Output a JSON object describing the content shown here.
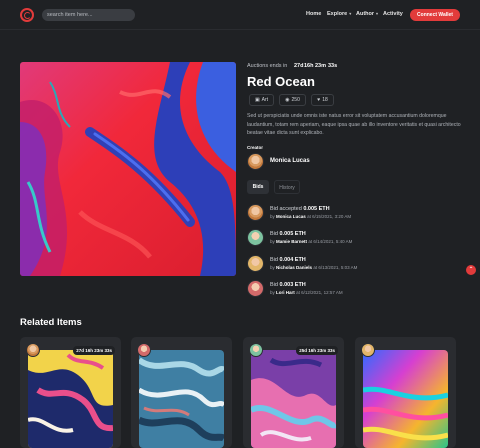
{
  "header": {
    "search_placeholder": "search item here...",
    "nav": {
      "home": "Home",
      "explore": "Explore",
      "author": "Author",
      "activity": "Activity"
    },
    "connect_label": "Connect Wallet"
  },
  "item": {
    "auction_label": "Auctions ends in",
    "timer": {
      "d": "27d",
      "h": "16h",
      "m": "23m",
      "s": "33s"
    },
    "title": "Red Ocean",
    "chips": {
      "category": "Art",
      "views": "250",
      "likes": "18"
    },
    "description": "Sed ut perspiciatis unde omnis iste natus error sit voluptatem accusantium doloremque laudantium, totam rem aperiam, eaque ipsa quae ab illo inventore veritatis et quasi architecto beatae vitae dicta sunt explicabo.",
    "creator_label": "Creator",
    "creator_name": "Monica Lucas"
  },
  "tabs": {
    "bids": "Bids",
    "history": "History"
  },
  "bids": [
    {
      "prefix": "Bid accepted",
      "amount": "0.005 ETH",
      "by": "by",
      "bidder": "Monica Lucas",
      "at": "at 6/15/2021, 3:20 AM"
    },
    {
      "prefix": "Bid",
      "amount": "0.005 ETH",
      "by": "by",
      "bidder": "Mamie Barnett",
      "at": "at 6/14/2021, 5:40 AM"
    },
    {
      "prefix": "Bid",
      "amount": "0.004 ETH",
      "by": "by",
      "bidder": "Nicholas Daniels",
      "at": "at 6/13/2021, 5:03 AM"
    },
    {
      "prefix": "Bid",
      "amount": "0.003 ETH",
      "by": "by",
      "bidder": "Lori Hart",
      "at": "at 6/12/2021, 12:57 AM"
    }
  ],
  "scroll_top_icon": "chevron-up-icon",
  "related": {
    "title": "Related Items",
    "cards": [
      {
        "timer": "27d 16h 23m 33s"
      },
      {
        "timer": ""
      },
      {
        "timer": "25d 16h 23m 33s"
      },
      {
        "timer": ""
      }
    ]
  },
  "colors": {
    "accent": "#e23b3b",
    "background": "#1f2124",
    "card": "#2a2c30"
  }
}
